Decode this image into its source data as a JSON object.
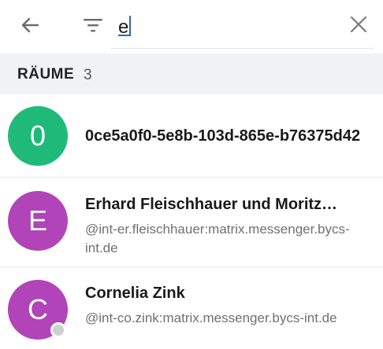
{
  "toolbar": {
    "back_icon": "arrow-left-icon",
    "filter_icon": "filter-icon",
    "search_value": "e",
    "clear_icon": "close-icon"
  },
  "section": {
    "title": "RÄUME",
    "count": "3"
  },
  "rooms": [
    {
      "initial": "0",
      "avatar_color": "#1fba7a",
      "title": "0ce5a0f0-5e8b-103d-865e-b76375d42",
      "subtitle": ""
    },
    {
      "initial": "E",
      "avatar_color": "#b044b8",
      "title": "Erhard Fleischhauer und Moritz…",
      "subtitle": "@int-er.fleischhauer:matrix.messenger.bycs-int.de"
    },
    {
      "initial": "C",
      "avatar_color": "#b044b8",
      "title": "Cornelia Zink",
      "subtitle": "@int-co.zink:matrix.messenger.bycs-int.de",
      "presence": "offline"
    }
  ]
}
